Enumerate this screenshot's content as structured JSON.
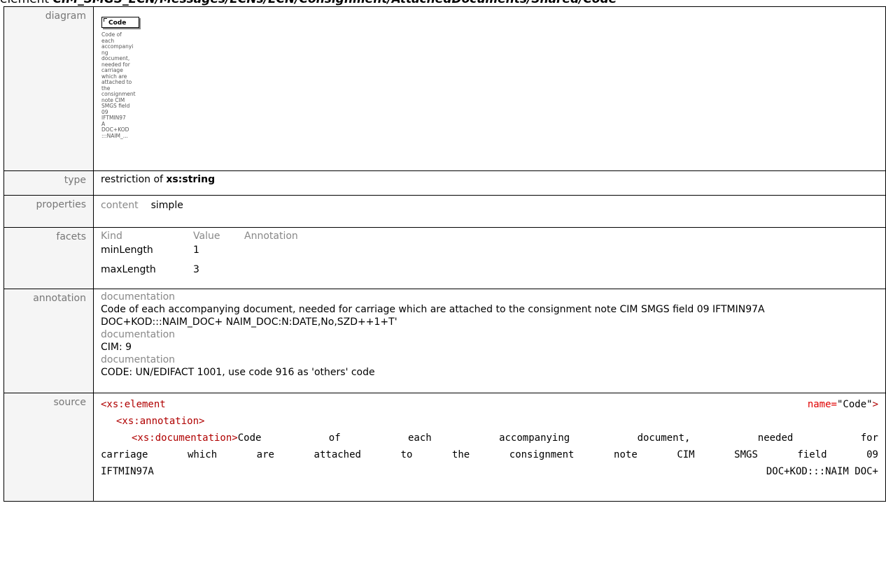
{
  "header": {
    "prefix": "element ",
    "path": "CIM_SMGS_ECN/Messages/ECNs/ECN/Consignment/AttachedDocuments/Shared/Code"
  },
  "rows": {
    "diagram": {
      "label": "diagram",
      "box_label": "Code",
      "doc_lines": [
        "Code of",
        "each",
        "accompanyi",
        "ng",
        "document,",
        "needed for",
        "carriage",
        "which are",
        "attached to",
        "the",
        "consignment",
        "note CIM",
        "SMGS field",
        "09",
        "IFTMIN97",
        "A",
        "DOC+KOD",
        ":::NAIM_..."
      ]
    },
    "type": {
      "label": "type",
      "prefix": "restriction of ",
      "base": "xs:string"
    },
    "properties": {
      "label": "properties",
      "key": "content",
      "value": "simple"
    },
    "facets": {
      "label": "facets",
      "headers": [
        "Kind",
        "Value",
        "Annotation"
      ],
      "items": [
        {
          "kind": "minLength",
          "value": "1"
        },
        {
          "kind": "maxLength",
          "value": "3"
        }
      ]
    },
    "annotation": {
      "label": "annotation",
      "docs": [
        {
          "label": "documentation",
          "text": "Code of each accompanying document, needed for carriage which are attached to the consignment note CIM SMGS field 09 IFTMIN97A  DOC+KOD:::NAIM_DOC+ NAIM_DOC:N:DATE,No,SZD++1+T'"
        },
        {
          "label": "documentation",
          "text": "CIM: 9"
        },
        {
          "label": "documentation",
          "text": "CODE: UN/EDIFACT 1001, use code 916 as 'others' code"
        }
      ]
    },
    "source": {
      "label": "source",
      "l1_tag": "<xs:element",
      "l1_attr": "name=",
      "l1_val": "\"Code\"",
      "l1_end": ">",
      "l2_tag": "<xs:annotation>",
      "l3_tag": "<xs:documentation>",
      "l3_text": "Code of each accompanying document, needed for",
      "l4_text": "carriage which are attached to the consignment note CIM SMGS field 09",
      "l5_a": "IFTMIN97A",
      "l5_b": "DOC+KOD:::NAIM DOC+"
    }
  }
}
